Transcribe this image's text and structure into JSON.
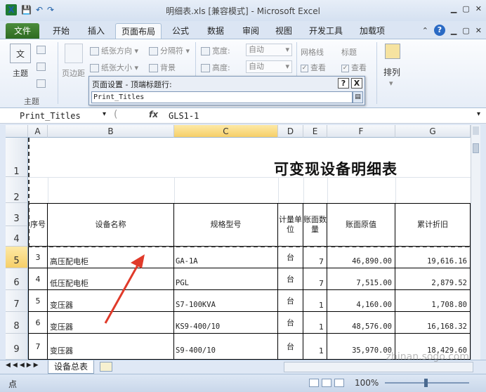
{
  "window": {
    "title": "明细表.xls [兼容模式] - Microsoft Excel"
  },
  "quick_access": {
    "logo": "X",
    "save": "💾",
    "undo": "↶",
    "redo": "↷"
  },
  "ribbon_tabs": [
    "文件",
    "开始",
    "插入",
    "页面布局",
    "公式",
    "数据",
    "审阅",
    "视图",
    "开发工具",
    "加载项"
  ],
  "active_tab": "页面布局",
  "ribbon": {
    "theme_label": "主题",
    "theme_group_label": "主题",
    "text_icon": "文",
    "margins_label": "页边距",
    "orientation_label": "纸张方向",
    "size_label": "纸张大小",
    "breaks_label": "分隔符",
    "background_label": "背景",
    "width_label": "宽度:",
    "width_value": "自动",
    "height_label": "高度:",
    "height_value": "自动",
    "gridlines_label": "网格线",
    "headings_label": "标题",
    "view_label": "查看",
    "view_label2": "查看",
    "arrange_label": "排列"
  },
  "dialog": {
    "title": "页面设置 - 顶端标题行:",
    "help": "?",
    "close": "X",
    "value": "Print_Titles"
  },
  "formula_bar": {
    "name_box": "Print_Titles",
    "fx": "fx",
    "content": "GLS1-1"
  },
  "columns": [
    "A",
    "B",
    "C",
    "D",
    "E",
    "F",
    "G"
  ],
  "rows": [
    "1",
    "2",
    "3",
    "4",
    "5",
    "6",
    "7",
    "8",
    "9"
  ],
  "sheet_title": "可变现设备明细表",
  "headers": {
    "seq": "序号",
    "name": "设备名称",
    "model": "规格型号",
    "unit": "计量单位",
    "qty": "账面数量",
    "orig": "账面原值",
    "dep": "累计折旧"
  },
  "data_rows": [
    {
      "seq": "3",
      "name": "高压配电柜",
      "model": "GA-1A",
      "unit": "台",
      "qty": "7",
      "orig": "46,890.00",
      "dep": "19,616.16"
    },
    {
      "seq": "4",
      "name": "低压配电柜",
      "model": "PGL",
      "unit": "台",
      "qty": "7",
      "orig": "7,515.00",
      "dep": "2,879.52"
    },
    {
      "seq": "5",
      "name": "变压器",
      "model": "S7-100KVA",
      "unit": "台",
      "qty": "1",
      "orig": "4,160.00",
      "dep": "1,708.80"
    },
    {
      "seq": "6",
      "name": "变压器",
      "model": "KS9-400/10",
      "unit": "台",
      "qty": "1",
      "orig": "48,576.00",
      "dep": "16,168.32"
    },
    {
      "seq": "7",
      "name": "变压器",
      "model": "S9-400/10",
      "unit": "台",
      "qty": "1",
      "orig": "35,970.00",
      "dep": "18,429.60"
    }
  ],
  "sheet_tabs": {
    "active": "设备总表"
  },
  "status": {
    "ready": "点",
    "zoom": "100%"
  },
  "watermark": "zhinan.sogo.com",
  "colors": {
    "file_tab": "#2e6b22",
    "selection": "#f6cf68",
    "arrow": "#e03a2a"
  }
}
